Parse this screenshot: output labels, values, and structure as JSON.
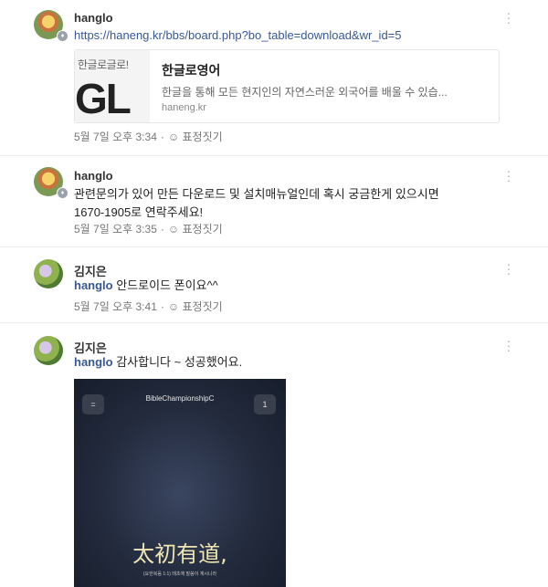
{
  "comments": [
    {
      "author": "hanglo",
      "text": "https://haneng.kr/bbs/board.php?bo_table=download&wr_id=5",
      "preview": {
        "thumb_top": "한글로글로!",
        "thumb_big": "GL",
        "title": "한글로영어",
        "description": "한글을 통해 모든 현지인의 자연스러운 외국어를 배울 수 있습...",
        "domain": "haneng.kr"
      },
      "time": "5월 7일 오후 3:34",
      "react_label": "표정짓기"
    },
    {
      "author": "hanglo",
      "text_line1": "관련문의가 있어 만든 다운로드 및 설치매뉴얼인데 혹시 궁금한게 있으시면",
      "text_line2": "1670-1905로 연락주세요!",
      "time": "5월 7일 오후 3:35",
      "react_label": "표정짓기"
    },
    {
      "author": "김지은",
      "mention": "hanglo",
      "text": " 안드로이드 폰이요^^",
      "time": "5월 7일 오후 3:41",
      "react_label": "표정짓기"
    },
    {
      "author": "김지은",
      "mention": "hanglo",
      "text": " 감사합니다 ~ 성공했어요.",
      "screenshot": {
        "title": "BibleChampionshipC",
        "left_button": "=",
        "right_button": "1",
        "main_text": "太初有道,",
        "sub_text": "(요한복음 1:1) 태초에 말씀이 계시니라"
      }
    }
  ],
  "icons": {
    "more": "kebab-icon",
    "emoji": "smile-icon",
    "verified": "admin-badge-icon"
  },
  "colors": {
    "link": "#385898",
    "meta": "#777777"
  }
}
